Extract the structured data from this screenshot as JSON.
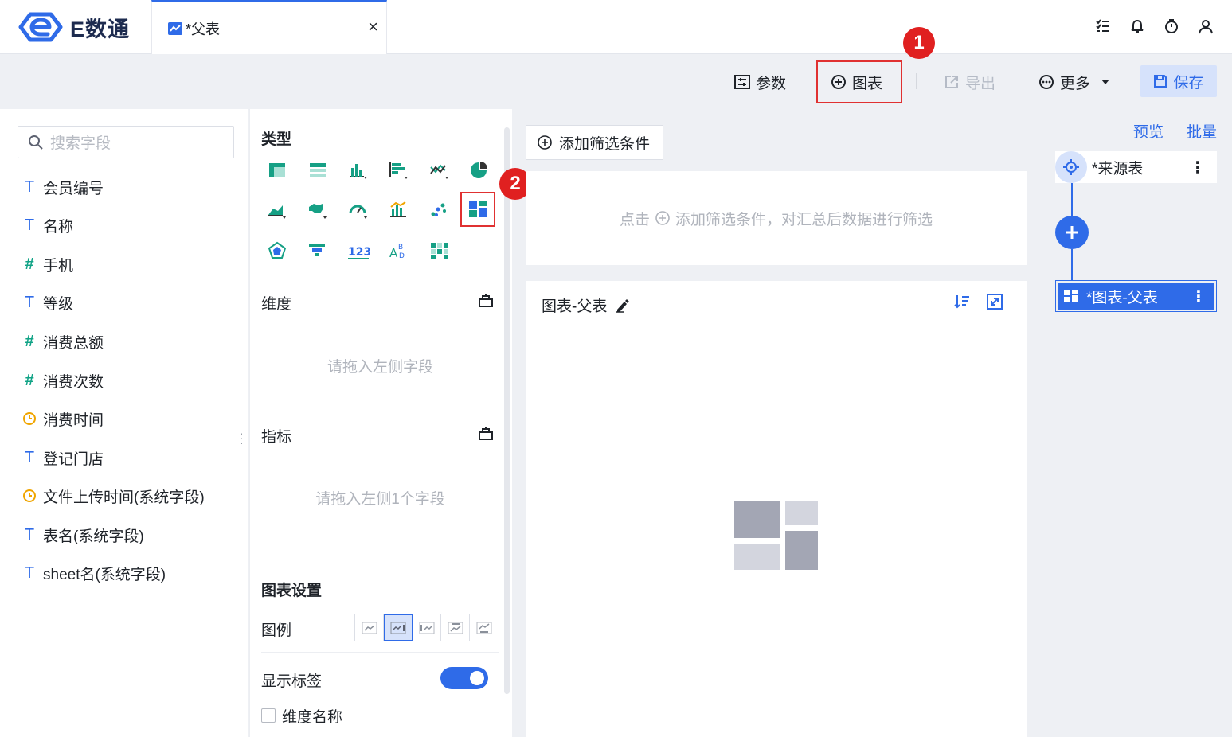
{
  "app": {
    "brand": "E数通"
  },
  "tab": {
    "label": "*父表",
    "close": "×"
  },
  "toolbar": {
    "params": "参数",
    "chart": "图表",
    "export": "导出",
    "more": "更多",
    "save": "保存"
  },
  "badges": {
    "one": "1",
    "two": "2"
  },
  "fields": {
    "search_placeholder": "搜索字段",
    "items": [
      {
        "type": "text",
        "label": "会员编号"
      },
      {
        "type": "text",
        "label": "名称"
      },
      {
        "type": "number",
        "label": "手机"
      },
      {
        "type": "text",
        "label": "等级"
      },
      {
        "type": "number",
        "label": "消费总额"
      },
      {
        "type": "number",
        "label": "消费次数"
      },
      {
        "type": "time",
        "label": "消费时间"
      },
      {
        "type": "text",
        "label": "登记门店"
      },
      {
        "type": "time",
        "label": "文件上传时间(系统字段)"
      },
      {
        "type": "text",
        "label": "表名(系统字段)"
      },
      {
        "type": "text",
        "label": "sheet名(系统字段)"
      }
    ]
  },
  "config": {
    "type_title": "类型",
    "dimension_title": "维度",
    "dimension_drop": "请拖入左侧字段",
    "metric_title": "指标",
    "metric_drop": "请拖入左侧1个字段",
    "settings_title": "图表设置",
    "legend_label": "图例",
    "show_label": "显示标签",
    "dim_name": "维度名称",
    "chart_types": [
      "table-icon",
      "grouped-table-icon",
      "bar-chart-icon",
      "horizontal-bar-icon",
      "line-chart-icon",
      "pie-chart-icon",
      "area-chart-icon",
      "map-icon",
      "gauge-icon",
      "combo-chart-icon",
      "scatter-icon",
      "card-layout-icon",
      "radar-icon",
      "funnel-icon",
      "kpi-number-icon",
      "word-cloud-icon",
      "heatmap-icon"
    ]
  },
  "center": {
    "add_filter": "添加筛选条件",
    "filter_hint_prefix": "点击",
    "filter_hint_suffix": "添加筛选条件，对汇总后数据进行筛选",
    "chart_title": "图表-父表"
  },
  "flow": {
    "preview": "预览",
    "batch": "批量",
    "source_node": "*来源表",
    "chart_node": "*图表-父表"
  },
  "colors": {
    "accent": "#2f6be8",
    "highlight": "#e03131",
    "badge": "#e02020"
  }
}
